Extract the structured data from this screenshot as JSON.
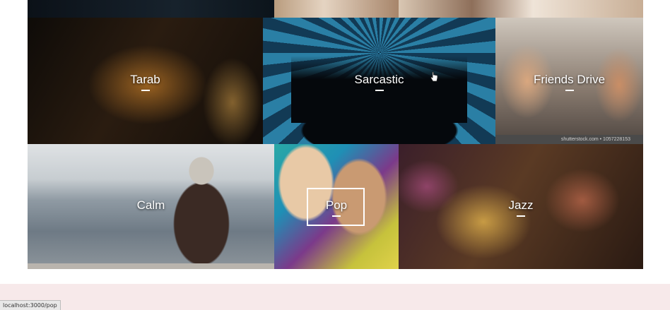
{
  "playlists": {
    "tarab": {
      "label": "Tarab"
    },
    "sarcastic": {
      "label": "Sarcastic"
    },
    "friends_drive": {
      "label": "Friends Drive",
      "image_credit": "shutterstock.com • 1057228153"
    },
    "calm": {
      "label": "Calm"
    },
    "pop": {
      "label": "Pop"
    },
    "jazz": {
      "label": "Jazz"
    }
  },
  "status_bar": {
    "url": "localhost:3000/pop"
  },
  "colors": {
    "label_text": "#ffffff",
    "footer_background": "#f7e9ea",
    "page_background": "#ffffff"
  }
}
